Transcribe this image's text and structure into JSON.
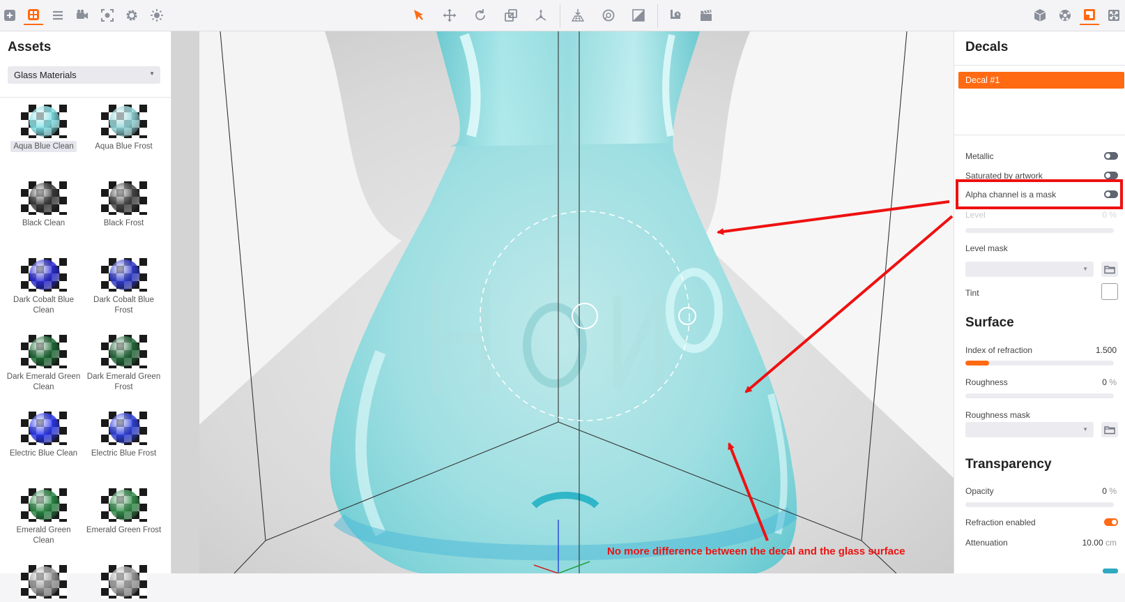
{
  "toolbar": {
    "left_icons": [
      "add-icon",
      "grid-icon",
      "menu-icon",
      "camera-icon",
      "focus-icon",
      "gear-icon",
      "light-icon"
    ],
    "center_icons": [
      "select-icon",
      "move-icon",
      "rotate-icon",
      "scale-icon",
      "pivot-icon",
      "ground-icon",
      "orbit-icon",
      "shade-icon",
      "clock-icon",
      "clapper-icon"
    ],
    "right_icons": [
      "cube-icon",
      "ball-icon",
      "layout-icon",
      "fullscreen-icon"
    ],
    "accent": "#ff6a13"
  },
  "assets": {
    "title": "Assets",
    "category": "Glass Materials",
    "items": [
      {
        "name": "Aqua Blue Clean",
        "color": "#7ee0e6",
        "selected": true
      },
      {
        "name": "Aqua Blue Frost",
        "color": "#8fd4d8"
      },
      {
        "name": "Black Clean",
        "color": "#3a3a3a"
      },
      {
        "name": "Black Frost",
        "color": "#444444"
      },
      {
        "name": "Dark Cobalt Blue Clean",
        "color": "#2a2ad8"
      },
      {
        "name": "Dark Cobalt Blue Frost",
        "color": "#2f3ad0"
      },
      {
        "name": "Dark Emerald Green Clean",
        "color": "#1d6b34"
      },
      {
        "name": "Dark Emerald Green Frost",
        "color": "#236b3a"
      },
      {
        "name": "Electric Blue Clean",
        "color": "#2a36f0"
      },
      {
        "name": "Electric Blue Frost",
        "color": "#2e40e0"
      },
      {
        "name": "Emerald Green Clean",
        "color": "#2a8a45"
      },
      {
        "name": "Emerald Green Frost",
        "color": "#35904c"
      },
      {
        "name": "",
        "color": "#9a9a9a"
      },
      {
        "name": "",
        "color": "#a0a0a0"
      }
    ]
  },
  "decals": {
    "title": "Decals",
    "selected_decal": "Decal #1",
    "metallic_label": "Metallic",
    "metallic_on": false,
    "saturated_label": "Saturated by artwork",
    "saturated_on": false,
    "alpha_mask_label": "Alpha channel is a mask",
    "alpha_mask_on": false,
    "level_label": "Level",
    "level_value": "0",
    "level_unit": "%",
    "level_mask_label": "Level mask",
    "tint_label": "Tint"
  },
  "surface": {
    "title": "Surface",
    "ior_label": "Index of refraction",
    "ior_value": "1.500",
    "ior_fraction": 0.16,
    "roughness_label": "Roughness",
    "roughness_value": "0",
    "roughness_unit": "%",
    "roughness_fraction": 0,
    "roughness_mask_label": "Roughness mask"
  },
  "transparency": {
    "title": "Transparency",
    "opacity_label": "Opacity",
    "opacity_value": "0",
    "opacity_unit": "%",
    "opacity_fraction": 0,
    "refraction_label": "Refraction enabled",
    "refraction_on": true,
    "attenuation_label": "Attenuation",
    "attenuation_value": "10.00",
    "attenuation_unit": "cm"
  },
  "annotation": {
    "caption": "No more difference between the decal and the glass surface",
    "color": "#ee1111"
  }
}
